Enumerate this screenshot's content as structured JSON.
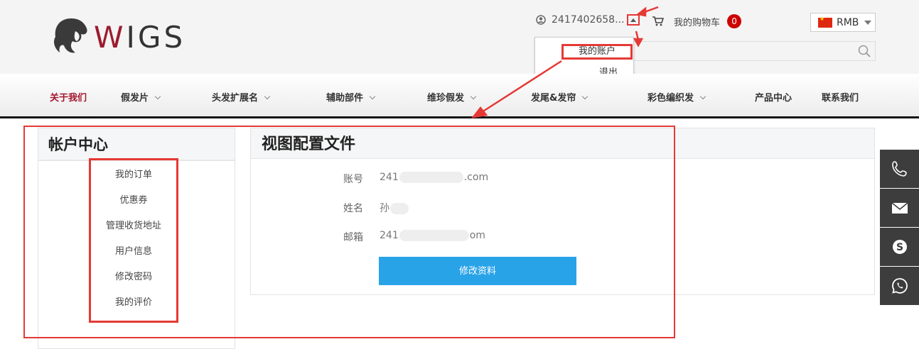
{
  "brand": {
    "logo_text_w": "W",
    "logo_text_rest": "IGS"
  },
  "header": {
    "username": "2417402658...",
    "cart_label": "我的购物车",
    "cart_count": "0",
    "currency": "RMB"
  },
  "user_menu": {
    "account": "我的账户",
    "logout": "退出"
  },
  "nav": [
    {
      "label": "关于我们",
      "dropdown": false
    },
    {
      "label": "假发片",
      "dropdown": true
    },
    {
      "label": "头发扩展名",
      "dropdown": true
    },
    {
      "label": "辅助部件",
      "dropdown": true
    },
    {
      "label": "维珍假发",
      "dropdown": true
    },
    {
      "label": "发尾&发帘",
      "dropdown": true
    },
    {
      "label": "彩色编织发",
      "dropdown": true
    },
    {
      "label": "产品中心",
      "dropdown": false
    },
    {
      "label": "联系我们",
      "dropdown": false
    }
  ],
  "sidebar": {
    "title": "帐户中心",
    "links": [
      "我的订单",
      "优惠券",
      "管理收货地址",
      "用户信息",
      "修改密码",
      "我的评价"
    ]
  },
  "profile": {
    "title": "视图配置文件",
    "account_label": "账号",
    "account_prefix": "241",
    "account_suffix": ".com",
    "name_label": "姓名",
    "name_prefix": "孙",
    "email_label": "邮箱",
    "email_prefix": "241",
    "email_suffix": "om",
    "edit_button": "修改资料"
  },
  "colors": {
    "accent": "#a3162c",
    "button": "#29a3e8",
    "annotation": "#e53935",
    "contact_bar": "#3d3d3d"
  },
  "contact_icons": [
    "phone-icon",
    "mail-icon",
    "skype-icon",
    "whatsapp-icon"
  ]
}
